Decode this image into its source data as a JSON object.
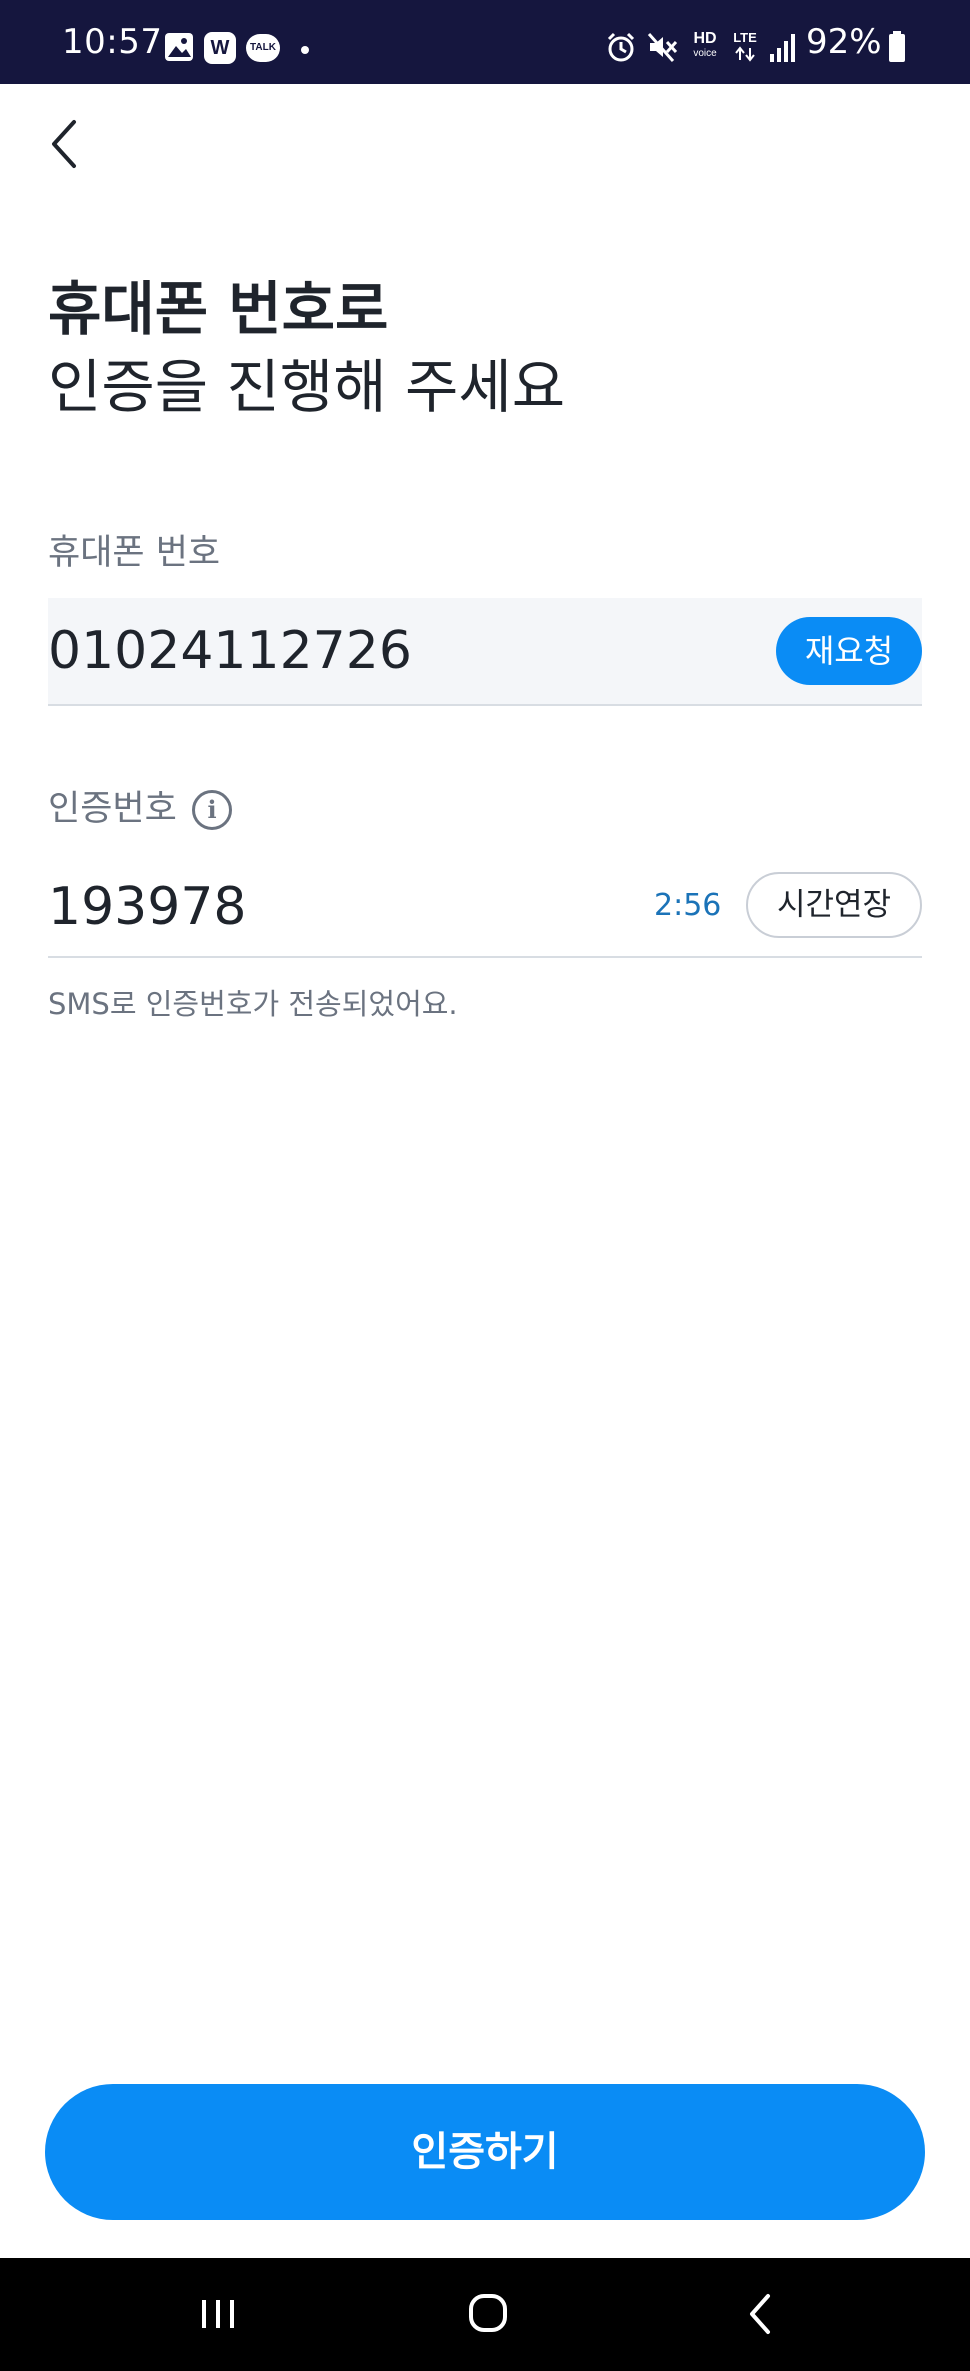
{
  "status_bar": {
    "time": "10:57",
    "battery": "92%",
    "icons": [
      "gallery-icon",
      "w-app-icon",
      "kakaotalk-icon",
      "dot-icon",
      "alarm-icon",
      "mute-icon",
      "hd-voice-icon",
      "lte-icon",
      "signal-icon",
      "battery-icon"
    ],
    "hd_label": "HD",
    "voice_label": "voice",
    "lte_label": "LTE",
    "w_label": "W",
    "talk_label": "TALK"
  },
  "header": {
    "back_icon": "chevron-left-icon",
    "title_line1": "휴대폰 번호로",
    "title_line2": "인증을 진행해 주세요"
  },
  "phone_field": {
    "label": "휴대폰 번호",
    "value": "01024112726",
    "resend_label": "재요청"
  },
  "code_field": {
    "label": "인증번호",
    "info_icon": "info-icon",
    "info_glyph": "i",
    "value": "193978",
    "timer": "2:56",
    "extend_label": "시간연장",
    "helper": "SMS로 인증번호가 전송되었어요."
  },
  "actions": {
    "verify_label": "인증하기"
  },
  "colors": {
    "status_bar_bg": "#15163e",
    "accent": "#0a8cf5",
    "timer": "#1b73b8",
    "text_primary": "#1f242c",
    "text_secondary": "#6b7380",
    "nav_bar_bg": "#000000"
  },
  "nav_bar": {
    "icons": [
      "recent-apps-icon",
      "home-icon",
      "back-icon"
    ]
  }
}
